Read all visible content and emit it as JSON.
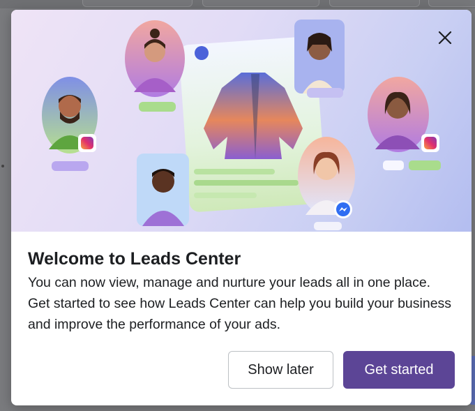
{
  "modal": {
    "title": "Welcome to Leads Center",
    "description": "You can now view, manage and nurture your leads all in one place. Get started to see how Leads Center can help you build your business and improve the performance of your ads.",
    "close_icon": "close-icon",
    "buttons": {
      "secondary_label": "Show later",
      "primary_label": "Get started"
    }
  },
  "colors": {
    "primary_button": "#5c4596",
    "hero_gradient_start": "#efe4f6",
    "hero_gradient_end": "#b3bdf0",
    "text": "#1c1e21"
  },
  "hero_icons": [
    "instagram-icon",
    "instagram-icon",
    "messenger-icon"
  ]
}
